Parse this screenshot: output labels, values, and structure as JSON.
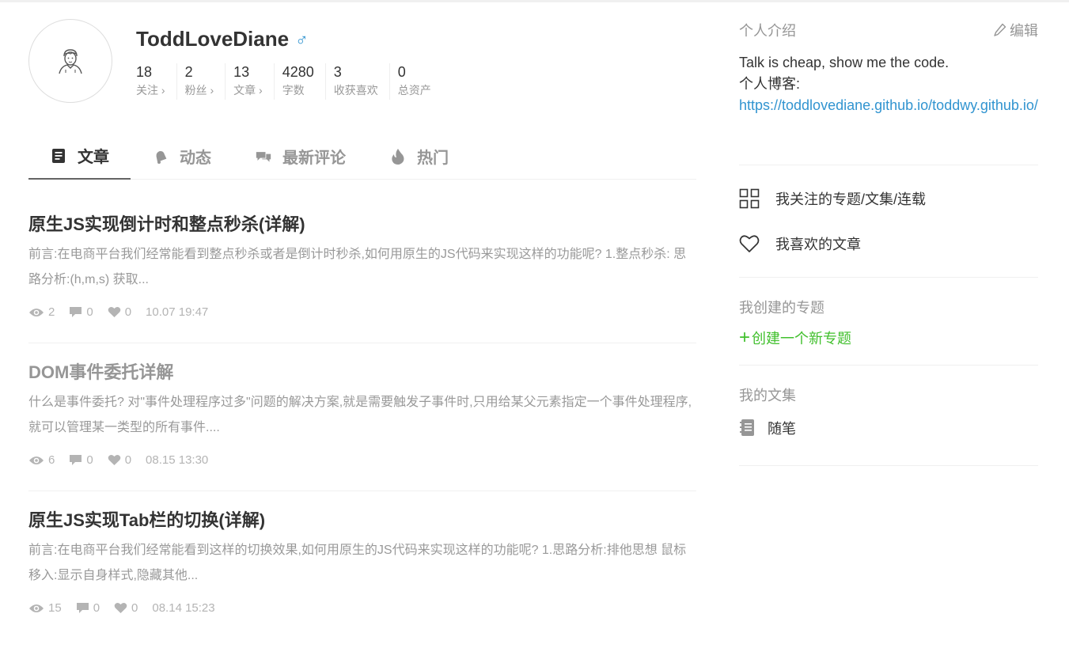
{
  "profile": {
    "username": "ToddLoveDiane",
    "gender_symbol": "♂",
    "stats": [
      {
        "num": "18",
        "label": "关注 ›"
      },
      {
        "num": "2",
        "label": "粉丝 ›"
      },
      {
        "num": "13",
        "label": "文章 ›"
      },
      {
        "num": "4280",
        "label": "字数"
      },
      {
        "num": "3",
        "label": "收获喜欢"
      },
      {
        "num": "0",
        "label": "总资产"
      }
    ]
  },
  "tabs": [
    {
      "label": "文章",
      "icon": "article-icon"
    },
    {
      "label": "动态",
      "icon": "bell-icon"
    },
    {
      "label": "最新评论",
      "icon": "comments-icon"
    },
    {
      "label": "热门",
      "icon": "fire-icon"
    }
  ],
  "articles": [
    {
      "title": "原生JS实现倒计时和整点秒杀(详解)",
      "abstract": "前言:在电商平台我们经常能看到整点秒杀或者是倒计时秒杀,如何用原生的JS代码来实现这样的功能呢? 1.整点秒杀: 思路分析:(h,m,s) 获取...",
      "views": "2",
      "comments": "0",
      "likes": "0",
      "time": "10.07 19:47"
    },
    {
      "title": "DOM事件委托详解",
      "abstract": "什么是事件委托? 对\"事件处理程序过多\"问题的解决方案,就是需要触发子事件时,只用给某父元素指定一个事件处理程序,就可以管理某一类型的所有事件....",
      "views": "6",
      "comments": "0",
      "likes": "0",
      "time": "08.15 13:30"
    },
    {
      "title": "原生JS实现Tab栏的切换(详解)",
      "abstract": "前言:在电商平台我们经常能看到这样的切换效果,如何用原生的JS代码来实现这样的功能呢? 1.思路分析:排他思想 鼠标移入:显示自身样式,隐藏其他...",
      "views": "15",
      "comments": "0",
      "likes": "0",
      "time": "08.14 15:23"
    }
  ],
  "sidebar": {
    "intro_title": "个人介绍",
    "edit_label": "编辑",
    "intro_line1": "Talk is cheap, show me the code.",
    "intro_line2": "个人博客:",
    "intro_link": "https://toddlovediane.github.io/toddwy.github.io/",
    "followed_topics": "我关注的专题/文集/连载",
    "liked_articles": "我喜欢的文章",
    "my_topics_title": "我创建的专题",
    "create_topic": "创建一个新专题",
    "my_notebooks_title": "我的文集",
    "notebook_name": "随笔"
  },
  "colors": {
    "link_blue": "#3194d0",
    "create_green": "#42c02e",
    "muted_gray": "#969696"
  }
}
